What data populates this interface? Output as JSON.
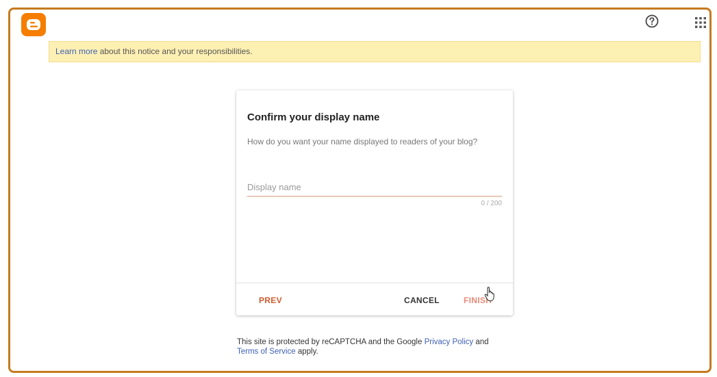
{
  "notice": {
    "link": "Learn more",
    "text": " about this notice and your responsibilities."
  },
  "dialog": {
    "title": "Confirm your display name",
    "subtitle": "How do you want your name displayed to readers of your blog?",
    "input_placeholder": "Display name",
    "input_value": "",
    "counter": "0 / 200",
    "prev_label": "PREV",
    "cancel_label": "CANCEL",
    "finish_label": "FINISH"
  },
  "footer": {
    "text1": "This site is protected by reCAPTCHA and the Google ",
    "privacy_link": "Privacy Policy",
    "text2": " and",
    "terms_link": "Terms of Service",
    "text3": " apply."
  },
  "icons": [
    "blogger-logo",
    "help-icon",
    "apps-icon"
  ],
  "colors": {
    "brand": "#f57d00",
    "frame": "#c57a1e",
    "notice_bg": "#fdf0b3",
    "accent": "#d05b2e",
    "link": "#3d5fb3"
  }
}
